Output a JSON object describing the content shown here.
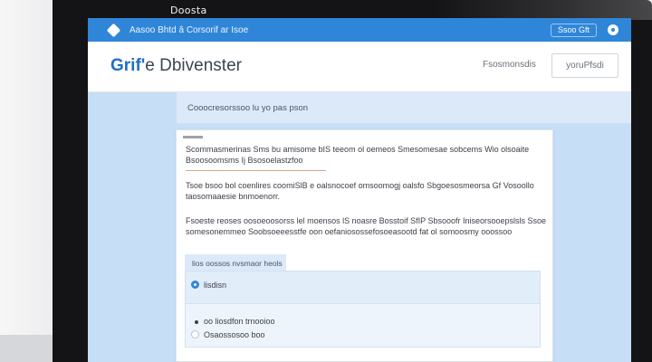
{
  "bezel": {
    "label": "Doosta"
  },
  "topbar": {
    "text": "Aasoo Bhtd â Corsorif ar Isoe",
    "pill": "Ssoo Gft"
  },
  "brandbar": {
    "brand_a": "Grif'",
    "brand_b": "e Dbivenster",
    "link": "Fsosmonsdis",
    "button": "yoruPfsdi"
  },
  "subbar": {
    "text": "Cooocresorssoo lu yo pas pson"
  },
  "card": {
    "para1": "Scommasmerinas Sms bu amisome bIS teeom ol oemeos Smesomesae sobcems Wio olsoaite Bsoosoomsms Ij Bsosoelastzfoo",
    "para2": "Tsoe bsoo bol coenlires coomiSlB e oalsnocoef omsoomogj oalsfo Sbgoesosmeorsa Gf Vosoollo taosomaaesie bnmoenorr.",
    "para3": "Fsoeste reoses oosoeoosorss lel moensos lS noasre Bosstoif SfIP Sbsooofr Iniseorsooepslsls Ssoe somesonemmeo Soobsoeeesstfe oon oefaniosossefosoeasootd fat ol somoosmy ooossoo"
  },
  "options": {
    "tab_label": "lios oossos nvsmaor heols",
    "option1": "lisdisn",
    "option2_prefix": "a",
    "option2": "oo liosdfon trnooioo",
    "option3": "Osaossosoo boo"
  }
}
